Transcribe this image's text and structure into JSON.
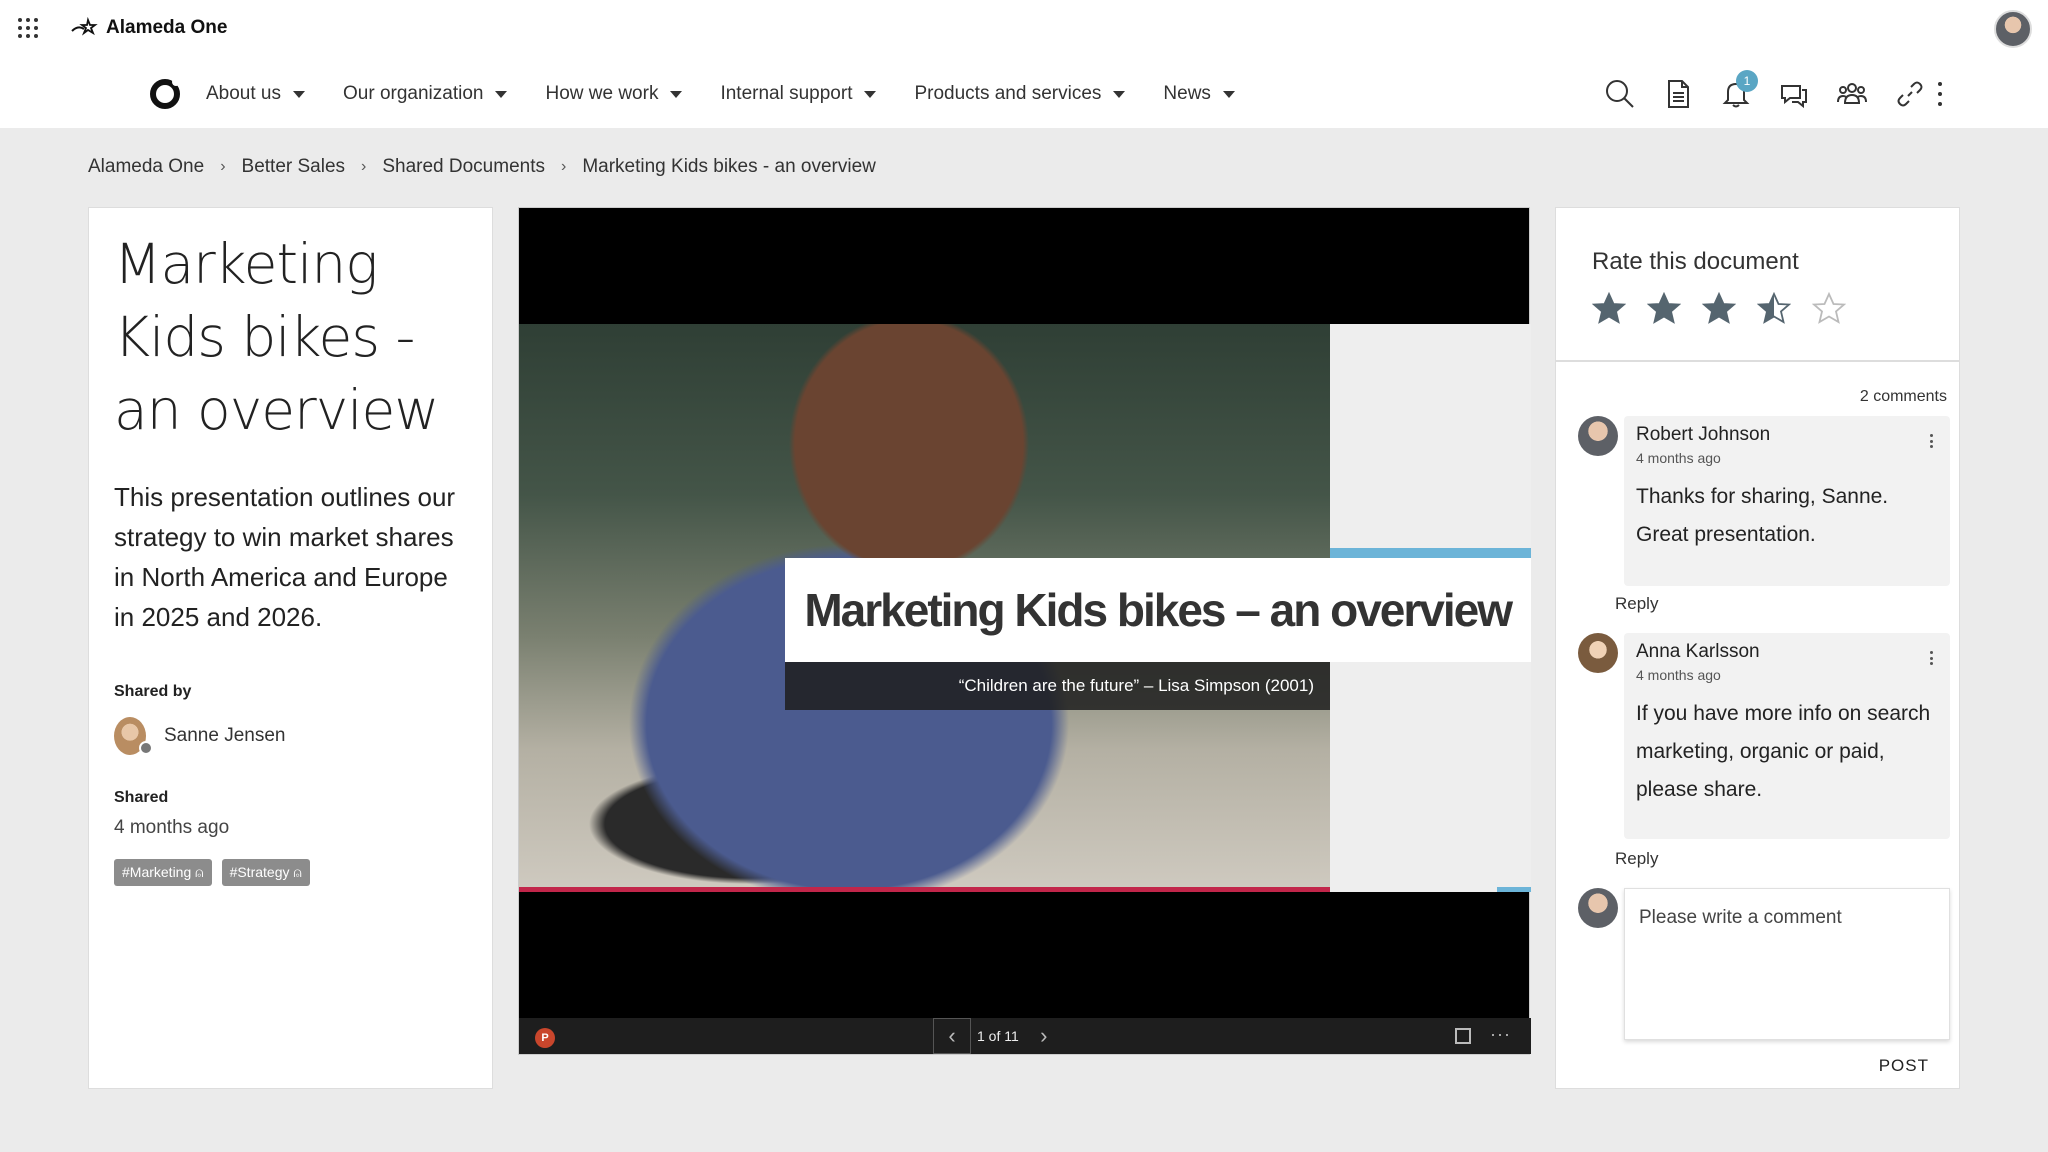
{
  "app": {
    "name": "Alameda One"
  },
  "nav": {
    "items": [
      {
        "label": "About us"
      },
      {
        "label": "Our organization"
      },
      {
        "label": "How we work"
      },
      {
        "label": "Internal support"
      },
      {
        "label": "Products and services"
      },
      {
        "label": "News"
      }
    ],
    "notifications_count": "1"
  },
  "breadcrumb": [
    "Alameda One",
    "Better Sales",
    "Shared Documents",
    "Marketing Kids bikes - an overview"
  ],
  "document": {
    "title": "Marketing Kids bikes - an overview",
    "description": "This presentation outlines our strategy to win market shares in North America and Europe in 2025 and 2026.",
    "shared_by_label": "Shared by",
    "shared_by": "Sanne Jensen",
    "shared_label": "Shared",
    "shared_time": "4 months ago",
    "tags": [
      "#Marketing",
      "#Strategy"
    ]
  },
  "viewer": {
    "slide_title": "Marketing Kids bikes – an overview",
    "slide_quote": "“Children are the future” – Lisa Simpson (2001)",
    "page_text": "1 of 11",
    "app_badge": "P",
    "more": "···"
  },
  "rating": {
    "title": "Rate this document",
    "value": 3.5,
    "max": 5,
    "color": "#55656f"
  },
  "comments": {
    "count_label": "2 comments",
    "items": [
      {
        "name": "Robert Johnson",
        "time": "4 months ago",
        "text": "Thanks for sharing, Sanne. Great presentation.",
        "reply": "Reply"
      },
      {
        "name": "Anna Karlsson",
        "time": "4 months ago",
        "text": "If you have more info on search marketing, organic or paid, please share.",
        "reply": "Reply"
      }
    ],
    "input_placeholder": "Please write a comment",
    "post_label": "POST"
  },
  "icons": [
    "waffle-icon",
    "search-icon",
    "document-icon",
    "bell-icon",
    "chat-icon",
    "people-icon",
    "link-icon",
    "more-vertical-icon",
    "powerpoint-icon",
    "fullscreen-icon",
    "star-icon"
  ]
}
